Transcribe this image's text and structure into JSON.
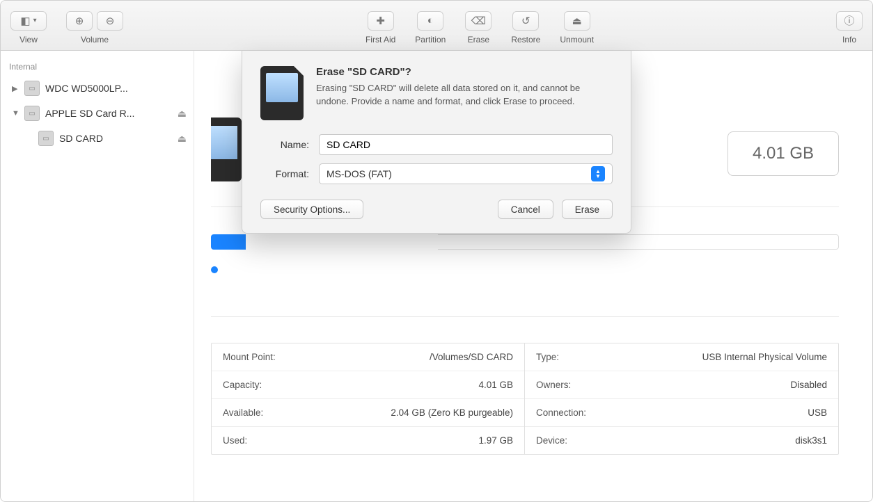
{
  "toolbar": {
    "view_label": "View",
    "volume_label": "Volume",
    "firstaid_label": "First Aid",
    "partition_label": "Partition",
    "erase_label": "Erase",
    "restore_label": "Restore",
    "unmount_label": "Unmount",
    "info_label": "Info"
  },
  "sidebar": {
    "header": "Internal",
    "items": [
      {
        "label": "WDC WD5000LP...",
        "expanded": false,
        "ejectable": false
      },
      {
        "label": "APPLE SD Card R...",
        "expanded": true,
        "ejectable": true
      },
      {
        "label": "SD CARD",
        "child": true,
        "ejectable": true
      }
    ]
  },
  "main": {
    "capacity": "4.01 GB"
  },
  "info": {
    "left": [
      {
        "k": "Mount Point:",
        "v": "/Volumes/SD CARD"
      },
      {
        "k": "Capacity:",
        "v": "4.01 GB"
      },
      {
        "k": "Available:",
        "v": "2.04 GB (Zero KB purgeable)"
      },
      {
        "k": "Used:",
        "v": "1.97 GB"
      }
    ],
    "right": [
      {
        "k": "Type:",
        "v": "USB Internal Physical Volume"
      },
      {
        "k": "Owners:",
        "v": "Disabled"
      },
      {
        "k": "Connection:",
        "v": "USB"
      },
      {
        "k": "Device:",
        "v": "disk3s1"
      }
    ]
  },
  "dialog": {
    "title": "Erase \"SD CARD\"?",
    "body": "Erasing \"SD CARD\" will delete all data stored on it, and cannot be undone. Provide a name and format, and click Erase to proceed.",
    "name_label": "Name:",
    "name_value": "SD CARD",
    "format_label": "Format:",
    "format_value": "MS-DOS (FAT)",
    "security_options": "Security Options...",
    "cancel": "Cancel",
    "erase": "Erase"
  }
}
